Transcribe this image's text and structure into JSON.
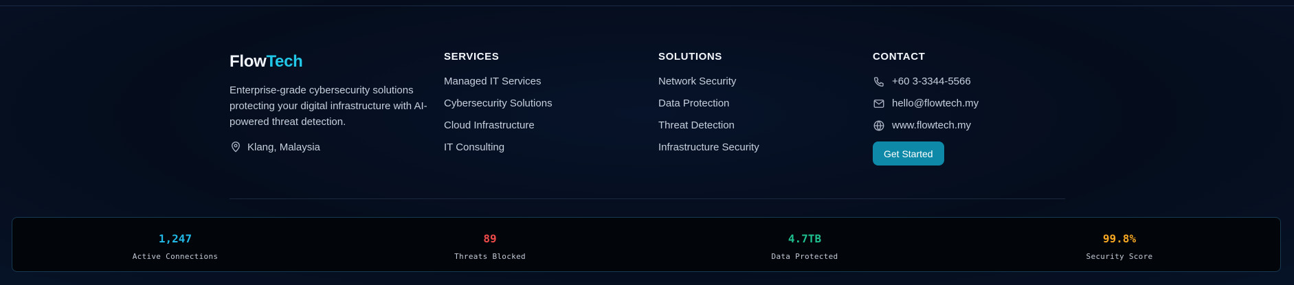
{
  "brand": {
    "name_part1": "Flow",
    "name_part2": "Tech",
    "description": "Enterprise-grade cybersecurity solutions protecting your digital infrastructure with AI-powered threat detection.",
    "location": "Klang, Malaysia",
    "location_icon": "map-pin-icon"
  },
  "services": {
    "title": "SERVICES",
    "items": [
      "Managed IT Services",
      "Cybersecurity Solutions",
      "Cloud Infrastructure",
      "IT Consulting"
    ]
  },
  "solutions": {
    "title": "SOLUTIONS",
    "items": [
      "Network Security",
      "Data Protection",
      "Threat Detection",
      "Infrastructure Security"
    ]
  },
  "contact": {
    "title": "CONTACT",
    "phone": "+60 3-3344-5566",
    "email": "hello@flowtech.my",
    "website": "www.flowtech.my",
    "phone_icon": "phone-icon",
    "email_icon": "mail-icon",
    "website_icon": "globe-icon",
    "cta_label": "Get Started"
  },
  "stats": [
    {
      "value": "1,247",
      "label": "Active Connections",
      "color": "#22b8e6"
    },
    {
      "value": "89",
      "label": "Threats Blocked",
      "color": "#ee4a4a"
    },
    {
      "value": "4.7TB",
      "label": "Data Protected",
      "color": "#1fbf8f"
    },
    {
      "value": "99.8%",
      "label": "Security Score",
      "color": "#f5a623"
    }
  ],
  "colors": {
    "accent": "#22c6e6",
    "button": "#0e8aa8",
    "background": "#050d1c"
  }
}
